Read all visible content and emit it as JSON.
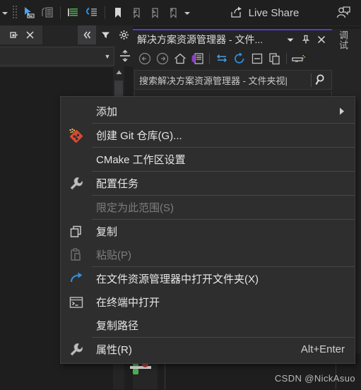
{
  "toolbar": {
    "icons": [
      {
        "name": "dropdown-caret-icon",
        "glyph": "caret"
      },
      {
        "name": "drag-handle-icon",
        "glyph": "dots"
      },
      {
        "name": "pointer-select-icon",
        "glyph": "pointer"
      },
      {
        "name": "comment-block-icon",
        "glyph": "comment"
      },
      {
        "name": "indent-decrease-icon",
        "glyph": "indent-dec"
      },
      {
        "name": "indent-increase-icon",
        "glyph": "indent-inc"
      },
      {
        "name": "bookmark-toggle-icon",
        "glyph": "bookmark-filled"
      },
      {
        "name": "bookmark-previous-icon",
        "glyph": "bookmark-prev"
      },
      {
        "name": "bookmark-next-icon",
        "glyph": "bookmark-next"
      },
      {
        "name": "bookmark-clear-icon",
        "glyph": "bookmark-clear"
      },
      {
        "name": "overflow-caret-icon",
        "glyph": "caret"
      }
    ],
    "live_share_label": "Live Share",
    "live_share_icon": "share-arrow-icon",
    "account_icon": "user-account-icon"
  },
  "left_panel": {
    "tab": {
      "pin_icon": "pin-icon",
      "close_icon": "close-icon"
    },
    "tools": [
      {
        "name": "collapse-all-icon",
        "glyph": "chevrons-left"
      },
      {
        "name": "filter-icon",
        "glyph": "funnel"
      },
      {
        "name": "settings-gear-icon",
        "glyph": "gear"
      }
    ],
    "combo": {
      "value": "",
      "placeholder": "",
      "dropdown_icon": "chevron-down-icon"
    },
    "splitter_icon": "split-horizontal-icon",
    "scroll_up_icon": "scroll-up-arrow-icon"
  },
  "solution_explorer": {
    "title": "解决方案资源管理器 - 文件...",
    "accent_color": "#4b3fd0",
    "title_buttons": [
      {
        "name": "panel-dropdown-icon",
        "glyph": "caret"
      },
      {
        "name": "pin-icon",
        "glyph": "pin"
      },
      {
        "name": "close-icon",
        "glyph": "close"
      }
    ],
    "toolbar_icons": [
      {
        "name": "navigate-back-icon",
        "glyph": "arrow-left-circle"
      },
      {
        "name": "navigate-forward-icon",
        "glyph": "arrow-right-circle"
      },
      {
        "name": "home-icon",
        "glyph": "home"
      },
      {
        "name": "solution-view-icon",
        "glyph": "vs-logo"
      },
      {
        "name": "sync-with-active-document-icon",
        "glyph": "sync-arrows"
      },
      {
        "name": "refresh-icon",
        "glyph": "refresh"
      },
      {
        "name": "collapse-all-icon",
        "glyph": "collapse-box"
      },
      {
        "name": "show-all-files-icon",
        "glyph": "copy-files"
      },
      {
        "name": "properties-icon",
        "glyph": "properties"
      }
    ],
    "search": {
      "value": "搜索解决方案资源管理器 - 文件夹视|",
      "search_icon": "search-icon"
    }
  },
  "right_strip": {
    "vertical_tab_label": "调试"
  },
  "context_menu": {
    "items": [
      {
        "label": "添加",
        "icon": "",
        "disabled": false,
        "submenu": true,
        "accel": "",
        "separator_after": true
      },
      {
        "label": "创建 Git 仓库(G)...",
        "icon": "git-repository-icon",
        "disabled": false,
        "submenu": false,
        "accel": "",
        "separator_after": true
      },
      {
        "label": "CMake 工作区设置",
        "icon": "",
        "disabled": false,
        "submenu": false,
        "accel": "",
        "separator_after": true
      },
      {
        "label": "配置任务",
        "icon": "wrench-icon",
        "disabled": false,
        "submenu": false,
        "accel": "",
        "separator_after": true
      },
      {
        "label": "限定为此范围(S)",
        "icon": "",
        "disabled": true,
        "submenu": false,
        "accel": "",
        "separator_after": true
      },
      {
        "label": "复制",
        "icon": "copy-icon",
        "disabled": false,
        "submenu": false,
        "accel": "",
        "separator_after": false
      },
      {
        "label": "粘贴(P)",
        "icon": "paste-icon",
        "disabled": true,
        "submenu": false,
        "accel": "",
        "separator_after": true
      },
      {
        "label": "在文件资源管理器中打开文件夹(X)",
        "icon": "open-folder-arrow-icon",
        "disabled": false,
        "submenu": false,
        "accel": "",
        "separator_after": false
      },
      {
        "label": "在终端中打开",
        "icon": "terminal-icon",
        "disabled": false,
        "submenu": false,
        "accel": "",
        "separator_after": false
      },
      {
        "label": "复制路径",
        "icon": "",
        "disabled": false,
        "submenu": false,
        "accel": "",
        "separator_after": true
      },
      {
        "label": "属性(R)",
        "icon": "wrench-icon",
        "disabled": false,
        "submenu": false,
        "accel": "Alt+Enter",
        "separator_after": false
      }
    ]
  },
  "watermark": {
    "text": "CSDN @NickAsuo"
  }
}
